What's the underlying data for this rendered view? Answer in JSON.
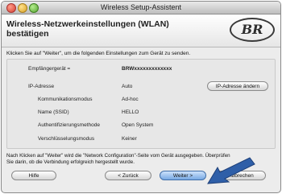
{
  "window_title": "Wireless Setup-Assistent",
  "header": {
    "title_line1": "Wireless-Netzwerkeinstellungen (WLAN)",
    "title_line2": "bestätigen",
    "logo_text": "BR"
  },
  "instruction": "Klicken Sie auf \"Weiter\", um die folgenden Einstellungen zum Gerät zu senden.",
  "settings": {
    "receiver_label": "Empfängergerät =",
    "receiver_value": "BRWxxxxxxxxxxxxx",
    "ip_label": "IP-Adresse",
    "ip_value": "Auto",
    "ip_change_button": "IP-Adresse ändern",
    "mode_label": "Kommunikationsmodus",
    "mode_value": "Ad-hoc",
    "ssid_label": "Name (SSID)",
    "ssid_value": "HELLO",
    "auth_label": "Authentifizierungsmethode",
    "auth_value": "Open System",
    "enc_label": "Verschlüsselungsmodus",
    "enc_value": "Keiner"
  },
  "footer": {
    "text_line1": "Nach Klicken auf \"Weiter\" wird die \"Network Configuration\"-Seite vom Gerät ausgegeben. Überprüfen",
    "text_line2": "Sie darin, ob die Verbindung erfolgreich hergestellt wurde."
  },
  "buttons": {
    "help": "Hilfe",
    "back": "< Zurück",
    "next": "Weiter >",
    "cancel": "Abbrechen"
  }
}
